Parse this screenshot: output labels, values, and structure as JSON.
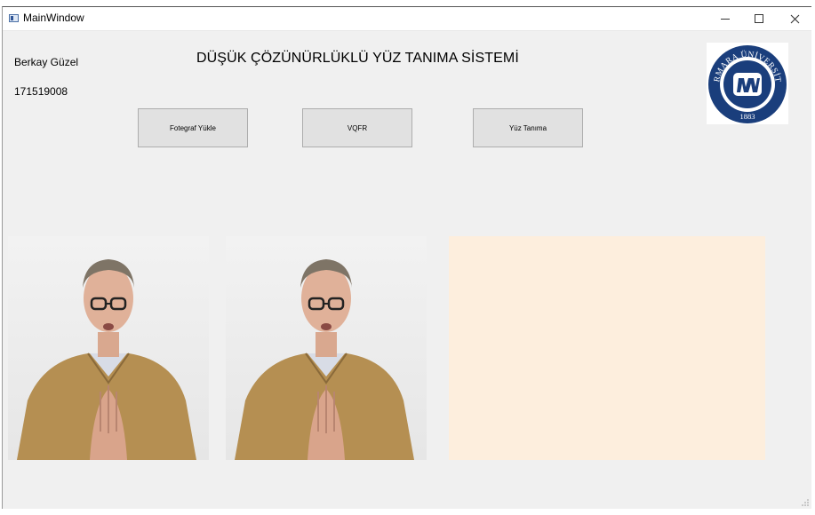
{
  "window": {
    "title": "MainWindow"
  },
  "student": {
    "name": "Berkay Güzel",
    "number": "171519008"
  },
  "header": {
    "title": "DÜŞÜK ÇÖZÜNÜRLÜKLÜ YÜZ TANIMA SİSTEMİ"
  },
  "logo": {
    "arc_text": "MARMARA ÜNİVERSİTESİ",
    "year": "1883",
    "brand_color": "#1a3e7c"
  },
  "toolbar": {
    "upload_label": "Fotegraf Yükle",
    "vqfr_label": "VQFR",
    "recognize_label": "Yüz Tanıma"
  },
  "panels": {
    "result_color": "#fdeedd"
  }
}
